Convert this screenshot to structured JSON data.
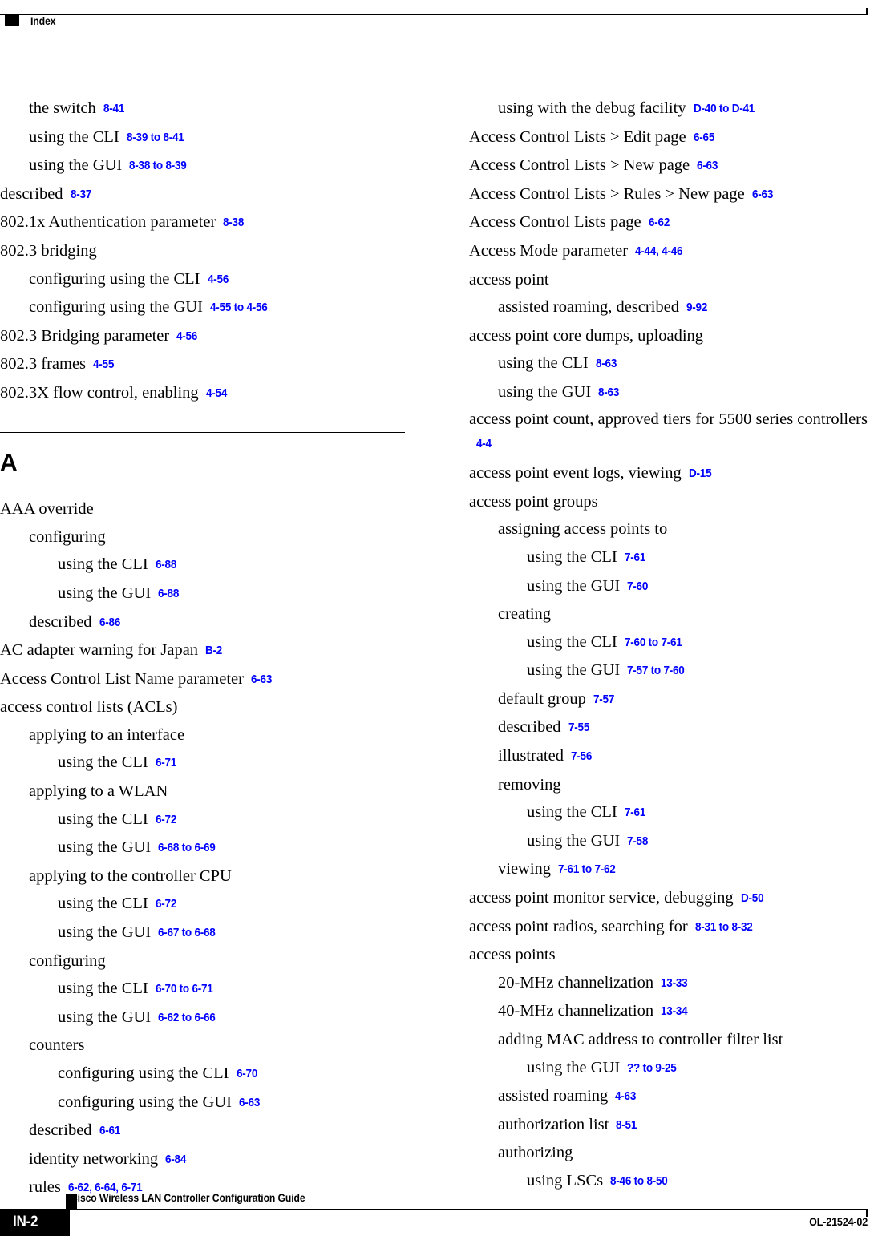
{
  "header": {
    "title": "Index",
    "marker_icon": "black-square-marker"
  },
  "footer": {
    "guide_title": "Cisco Wireless LAN Controller Configuration Guide",
    "page_number": "IN-2",
    "doc_id": "OL-21524-02",
    "marker_icon": "black-square-marker"
  },
  "columns": {
    "left": {
      "entries": [
        {
          "level": 1,
          "term": "the switch",
          "pages": "8-41"
        },
        {
          "level": 1,
          "term": "using the CLI",
          "pages": "8-39 to 8-41"
        },
        {
          "level": 1,
          "term": "using the GUI",
          "pages": "8-38 to 8-39"
        },
        {
          "level": 0,
          "term": "described",
          "pages": "8-37",
          "indent_half": true
        },
        {
          "level": 0,
          "term": "802.1x Authentication parameter",
          "pages": "8-38"
        },
        {
          "level": 0,
          "term": "802.3 bridging",
          "pages": ""
        },
        {
          "level": 1,
          "term": "configuring using the CLI",
          "pages": "4-56",
          "indent_half": true
        },
        {
          "level": 1,
          "term": "configuring using the GUI",
          "pages": "4-55 to 4-56",
          "indent_half": true
        },
        {
          "level": 0,
          "term": "802.3 Bridging parameter",
          "pages": "4-56"
        },
        {
          "level": 0,
          "term": "802.3 frames",
          "pages": "4-55"
        },
        {
          "level": 0,
          "term": "802.3X flow control, enabling",
          "pages": "4-54"
        }
      ],
      "section_letter": "A",
      "entries_after_section": [
        {
          "level": 0,
          "term": "AAA override",
          "pages": ""
        },
        {
          "level": 1,
          "term": "configuring",
          "pages": "",
          "indent_half": true
        },
        {
          "level": 2,
          "term": "using the CLI",
          "pages": "6-88"
        },
        {
          "level": 2,
          "term": "using the GUI",
          "pages": "6-88"
        },
        {
          "level": 1,
          "term": "described",
          "pages": "6-86",
          "indent_half": true
        },
        {
          "level": 0,
          "term": "AC adapter warning for Japan",
          "pages": "B-2"
        },
        {
          "level": 0,
          "term": "Access Control List Name parameter",
          "pages": "6-63"
        },
        {
          "level": 0,
          "term": "access control lists (ACLs)",
          "pages": ""
        },
        {
          "level": 1,
          "term": "applying to an interface",
          "pages": "",
          "indent_half": true
        },
        {
          "level": 2,
          "term": "using the CLI",
          "pages": "6-71"
        },
        {
          "level": 1,
          "term": "applying to a WLAN",
          "pages": "",
          "indent_half": true
        },
        {
          "level": 2,
          "term": "using the CLI",
          "pages": "6-72"
        },
        {
          "level": 2,
          "term": "using the GUI",
          "pages": "6-68 to 6-69"
        },
        {
          "level": 1,
          "term": "applying to the controller CPU",
          "pages": "",
          "indent_half": true
        },
        {
          "level": 2,
          "term": "using the CLI",
          "pages": "6-72"
        },
        {
          "level": 2,
          "term": "using the GUI",
          "pages": "6-67 to 6-68"
        },
        {
          "level": 1,
          "term": "configuring",
          "pages": "",
          "indent_half": true
        },
        {
          "level": 2,
          "term": "using the CLI",
          "pages": "6-70 to 6-71"
        },
        {
          "level": 2,
          "term": "using the GUI",
          "pages": "6-62 to 6-66"
        },
        {
          "level": 1,
          "term": "counters",
          "pages": "",
          "indent_half": true
        },
        {
          "level": 2,
          "term": "configuring using the CLI",
          "pages": "6-70"
        },
        {
          "level": 2,
          "term": "configuring using the GUI",
          "pages": "6-63"
        },
        {
          "level": 1,
          "term": "described",
          "pages": "6-61",
          "indent_half": true
        },
        {
          "level": 1,
          "term": "identity networking",
          "pages": "6-84",
          "indent_half": true
        },
        {
          "level": 1,
          "term": "rules",
          "pages": "6-62, 6-64, 6-71",
          "indent_half": true
        }
      ]
    },
    "right": {
      "entries": [
        {
          "level": 1,
          "term": "using with the debug facility",
          "pages": "D-40 to D-41"
        },
        {
          "level": 0,
          "term": "Access Control Lists > Edit page",
          "pages": "6-65"
        },
        {
          "level": 0,
          "term": "Access Control Lists > New page",
          "pages": "6-63"
        },
        {
          "level": 0,
          "term": "Access Control Lists > Rules > New page",
          "pages": "6-63"
        },
        {
          "level": 0,
          "term": "Access Control Lists page",
          "pages": "6-62"
        },
        {
          "level": 0,
          "term": "Access Mode parameter",
          "pages": "4-44, 4-46"
        },
        {
          "level": 0,
          "term": "access point",
          "pages": ""
        },
        {
          "level": 1,
          "term": "assisted roaming, described",
          "pages": "9-92"
        },
        {
          "level": 0,
          "term": "access point core dumps, uploading",
          "pages": ""
        },
        {
          "level": 1,
          "term": "using the CLI",
          "pages": "8-63"
        },
        {
          "level": 1,
          "term": "using the GUI",
          "pages": "8-63"
        },
        {
          "level": 0,
          "term": "access point count, approved tiers for 5500 series controllers",
          "pages": "4-4",
          "wrap": true
        },
        {
          "level": 0,
          "term": "access point event logs, viewing",
          "pages": "D-15"
        },
        {
          "level": 0,
          "term": "access point groups",
          "pages": ""
        },
        {
          "level": 1,
          "term": "assigning access points to",
          "pages": ""
        },
        {
          "level": 2,
          "term": "using the CLI",
          "pages": "7-61"
        },
        {
          "level": 2,
          "term": "using the GUI",
          "pages": "7-60"
        },
        {
          "level": 1,
          "term": "creating",
          "pages": ""
        },
        {
          "level": 2,
          "term": "using the CLI",
          "pages": "7-60 to 7-61"
        },
        {
          "level": 2,
          "term": "using the GUI",
          "pages": "7-57 to 7-60"
        },
        {
          "level": 1,
          "term": "default group",
          "pages": "7-57"
        },
        {
          "level": 1,
          "term": "described",
          "pages": "7-55"
        },
        {
          "level": 1,
          "term": "illustrated",
          "pages": "7-56"
        },
        {
          "level": 1,
          "term": "removing",
          "pages": ""
        },
        {
          "level": 2,
          "term": "using the CLI",
          "pages": "7-61"
        },
        {
          "level": 2,
          "term": "using the GUI",
          "pages": "7-58"
        },
        {
          "level": 1,
          "term": "viewing",
          "pages": "7-61 to 7-62"
        },
        {
          "level": 0,
          "term": "access point monitor service, debugging",
          "pages": "D-50"
        },
        {
          "level": 0,
          "term": "access point radios, searching for",
          "pages": "8-31 to 8-32"
        },
        {
          "level": 0,
          "term": "access points",
          "pages": ""
        },
        {
          "level": 1,
          "term": "20-MHz channelization",
          "pages": "13-33"
        },
        {
          "level": 1,
          "term": "40-MHz channelization",
          "pages": "13-34"
        },
        {
          "level": 1,
          "term": "adding MAC address to controller filter list",
          "pages": ""
        },
        {
          "level": 2,
          "term": "using the GUI",
          "pages": "?? to 9-25"
        },
        {
          "level": 1,
          "term": "assisted roaming",
          "pages": "4-63"
        },
        {
          "level": 1,
          "term": "authorization list",
          "pages": "8-51"
        },
        {
          "level": 1,
          "term": "authorizing",
          "pages": ""
        },
        {
          "level": 2,
          "term": "using LSCs",
          "pages": "8-46 to 8-50"
        }
      ]
    }
  },
  "colors": {
    "page_ref": "#0000ff",
    "text": "#000000",
    "background": "#ffffff"
  }
}
